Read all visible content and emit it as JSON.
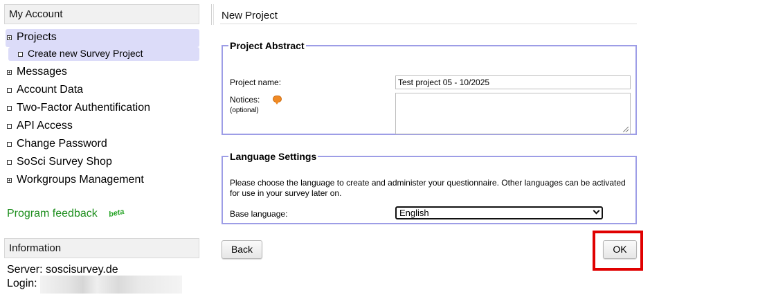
{
  "sidebar": {
    "account_header": "My Account",
    "items": [
      {
        "label": "Projects",
        "bullet": "plus",
        "active": true
      },
      {
        "label": "Create new Survey Project",
        "bullet": "square",
        "sub": true,
        "active": true
      },
      {
        "label": "Messages",
        "bullet": "plus"
      },
      {
        "label": "Account Data",
        "bullet": "square"
      },
      {
        "label": "Two-Factor Authentification",
        "bullet": "square"
      },
      {
        "label": "API Access",
        "bullet": "square"
      },
      {
        "label": "Change Password",
        "bullet": "square"
      },
      {
        "label": "SoSci Survey Shop",
        "bullet": "square"
      },
      {
        "label": "Workgroups Management",
        "bullet": "plus"
      }
    ],
    "feedback_label": "Program feedback",
    "beta_badge": "beta",
    "info_header": "Information",
    "server_text": "Server: soscisurvey.de",
    "login_text": "Login:"
  },
  "main": {
    "title": "New Project",
    "abstract": {
      "legend": "Project Abstract",
      "name_label": "Project name:",
      "name_value": "Test project 05 - 10/2025",
      "notices_label": "Notices:",
      "notices_optional": "(optional)",
      "notices_value": ""
    },
    "language": {
      "legend": "Language Settings",
      "help": "Please choose the language to create and administer your questionnaire. Other languages can be activated for use in your survey later on.",
      "base_label": "Base language:",
      "base_value": "English"
    },
    "back_label": "Back",
    "ok_label": "OK"
  },
  "colors": {
    "panel_border": "#9d9de6",
    "active_nav": "#dcdcf9",
    "feedback_green": "#1f8f1f",
    "highlight_red": "#e00000"
  }
}
